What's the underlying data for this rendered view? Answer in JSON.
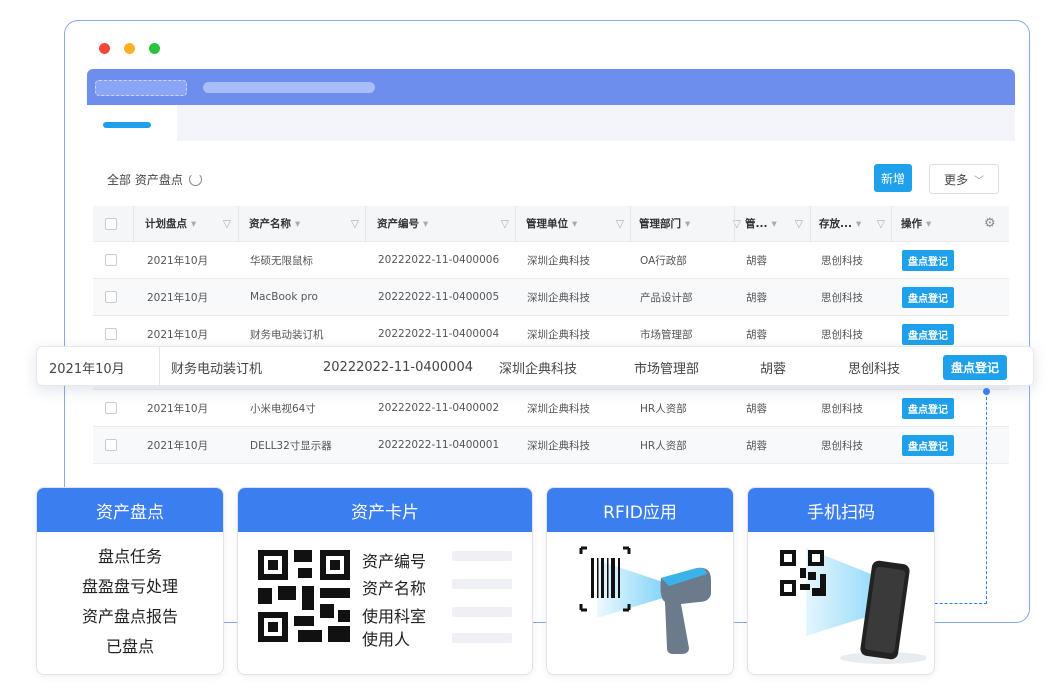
{
  "window": {
    "dot_colors": [
      "#f5483b",
      "#f9b227",
      "#2ac33d"
    ]
  },
  "toolbar": {
    "title": "全部 资产盘点",
    "new_label": "新增",
    "more_label": "更多",
    "more_chevron": "﹀"
  },
  "table": {
    "headers": [
      "计划盘点",
      "资产名称",
      "资产编号",
      "管理单位",
      "管理部门",
      "管...",
      "存放...",
      "操作"
    ],
    "rows": [
      {
        "plan": "2021年10月",
        "name": "华硕无限鼠标",
        "code": "20222022-11-0400006",
        "unit": "深圳企典科技",
        "dept": "OA行政部",
        "manager": "胡蓉",
        "storage": "思创科技",
        "action": "盘点登记"
      },
      {
        "plan": "2021年10月",
        "name": "MacBook pro",
        "code": "20222022-11-0400005",
        "unit": "深圳企典科技",
        "dept": "产品设计部",
        "manager": "胡蓉",
        "storage": "思创科技",
        "action": "盘点登记"
      },
      {
        "plan": "2021年10月",
        "name": "财务电动装订机",
        "code": "20222022-11-0400004",
        "unit": "深圳企典科技",
        "dept": "市场管理部",
        "manager": "胡蓉",
        "storage": "思创科技",
        "action": "盘点登记"
      },
      {
        "plan": "2021年10月",
        "name": "小米电视64寸",
        "code": "20222022-11-0400002",
        "unit": "深圳企典科技",
        "dept": "HR人资部",
        "manager": "胡蓉",
        "storage": "思创科技",
        "action": "盘点登记"
      },
      {
        "plan": "2021年10月",
        "name": "DELL32寸显示器",
        "code": "20222022-11-0400001",
        "unit": "深圳企典科技",
        "dept": "HR人资部",
        "manager": "胡蓉",
        "storage": "思创科技",
        "action": "盘点登记"
      }
    ]
  },
  "highlight_row": {
    "plan": "2021年10月",
    "name": "财务电动装订机",
    "code": "20222022-11-0400004",
    "unit": "深圳企典科技",
    "dept": "市场管理部",
    "manager": "胡蓉",
    "storage": "思创科技",
    "action": "盘点登记"
  },
  "cards": {
    "inventory": {
      "title": "资产盘点",
      "items": [
        "盘点任务",
        "盘盈盘亏处理",
        "资产盘点报告",
        "已盘点"
      ]
    },
    "asset_card": {
      "title": "资产卡片",
      "fields": [
        "资产编号",
        "资产名称",
        "使用科室",
        "使用人"
      ]
    },
    "rfid": {
      "title": "RFID应用"
    },
    "mobile": {
      "title": "手机扫码"
    }
  },
  "colors": {
    "accent": "#1fa0ea",
    "card_header": "#3a7ef0",
    "appbar": "#6e8eee"
  }
}
